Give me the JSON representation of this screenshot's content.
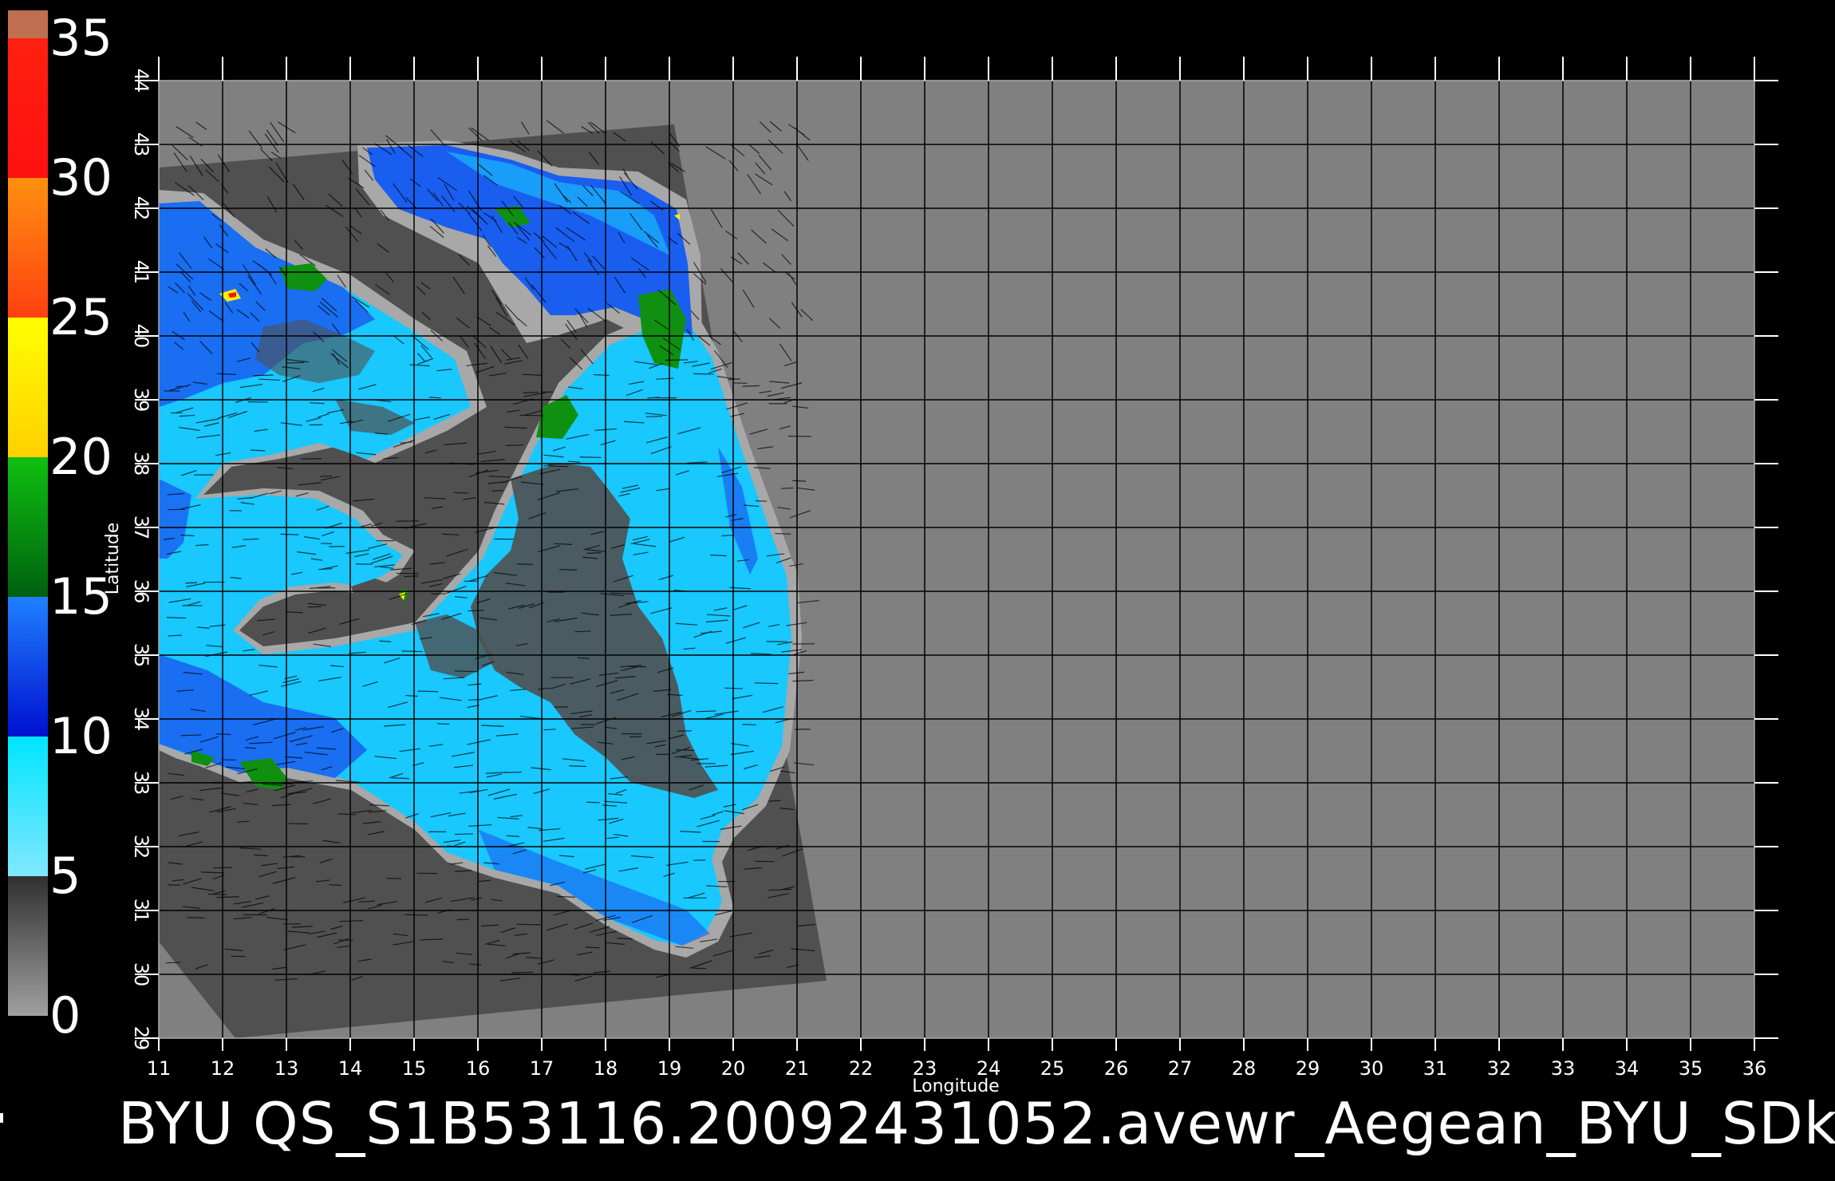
{
  "map": {
    "caption": "BYU  QS_S1B53116.20092431052.avewr_Aegean_BYU_SDk",
    "xlabel": "Longitude",
    "ylabel": "Latitude",
    "lon_ticks": [
      "11",
      "12",
      "13",
      "14",
      "15",
      "16",
      "17",
      "18",
      "19",
      "20",
      "21",
      "22",
      "23",
      "24",
      "25",
      "26",
      "27",
      "28",
      "29",
      "30",
      "31",
      "32",
      "33",
      "34",
      "35",
      "36"
    ],
    "lat_ticks": [
      "29",
      "30",
      "31",
      "32",
      "33",
      "34",
      "35",
      "36",
      "37",
      "38",
      "39",
      "40",
      "41",
      "42",
      "43",
      "44"
    ],
    "lon_range": [
      11,
      36
    ],
    "lat_range": [
      29,
      44
    ],
    "grid": true
  },
  "colorbar": {
    "labels": [
      "0",
      "5",
      "10",
      "15",
      "20",
      "25",
      "30",
      "35"
    ],
    "range": [
      0,
      35
    ],
    "colors": {
      "0-5": "#555555",
      "5-10": "#00e5ff",
      "10-15": "#1450e0",
      "15-20": "#109010",
      "20-25": "#ffee00",
      "25-30": "#ff6a10",
      "30-35": "#ff1010",
      "35+": "#c07050"
    }
  },
  "colors": {
    "background": "#000000",
    "no_data": "#808080",
    "swath_land": "#505050",
    "coast_band": "#a8a8a8",
    "wind_low": "#18c8ff",
    "wind_mid": "#1a5ef0",
    "gridline": "#000000"
  }
}
